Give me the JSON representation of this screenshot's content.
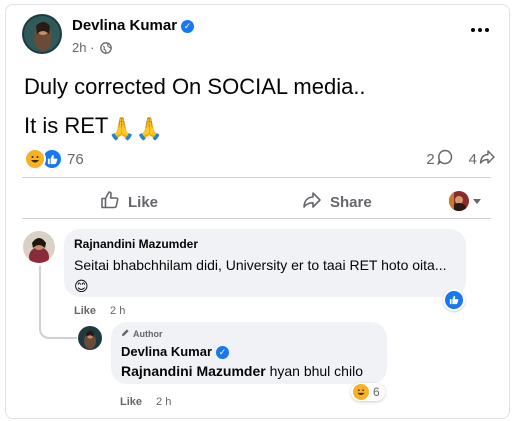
{
  "post": {
    "author": "Devlina Kumar",
    "time": "2h",
    "separator": "·",
    "verified_icon": "verified-check-icon",
    "text_line1": "Duly corrected On SOCIAL media..",
    "text_line2": "It is RET",
    "text_line2_emoji": "🙏🙏",
    "reaction_count": "76",
    "comment_count": "2",
    "share_count": "4"
  },
  "actions": {
    "like_label": "Like",
    "share_label": "Share"
  },
  "comments": [
    {
      "author": "Rajnandini Mazumder",
      "text": "Seitai bhabchhilam didi, University er to taai RET hoto oita...",
      "emoji": "😊",
      "like_label": "Like",
      "time": "2 h"
    },
    {
      "badge": "Author",
      "author": "Devlina Kumar",
      "mention": "Rajnandini Mazumder",
      "text": " hyan bhul chilo",
      "like_label": "Like",
      "time": "2 h",
      "reaction_count": "6"
    }
  ],
  "colors": {
    "accent": "#1877f2",
    "secondary_text": "#65676b",
    "bubble": "#f0f2f5",
    "haha": "#f7b125"
  }
}
